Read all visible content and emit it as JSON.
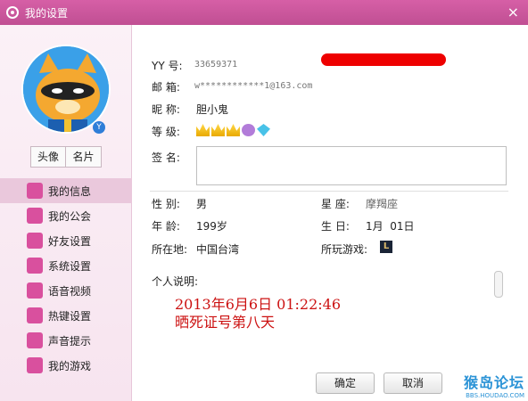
{
  "window": {
    "title": "我的设置",
    "close_label": "×"
  },
  "sidebar": {
    "avatar_badge": "Y",
    "tabs": [
      "头像",
      "名片"
    ],
    "items": [
      {
        "label": "我的信息",
        "icon": "profile-card-icon",
        "active": true
      },
      {
        "label": "我的公会",
        "icon": "flag-icon"
      },
      {
        "label": "好友设置",
        "icon": "friend-settings-icon"
      },
      {
        "label": "系统设置",
        "icon": "gear-icon"
      },
      {
        "label": "语音视频",
        "icon": "webcam-icon"
      },
      {
        "label": "热键设置",
        "icon": "keyboard-icon"
      },
      {
        "label": "声音提示",
        "icon": "music-note-icon"
      },
      {
        "label": "我的游戏",
        "icon": "game-icon"
      }
    ]
  },
  "profile": {
    "yy_label": "YY 号:",
    "yy_value": "33659371",
    "email_label": "邮 箱:",
    "email_value": "w************1@163.com",
    "nickname_label": "昵 称:",
    "nickname_value": "胆小鬼",
    "level_label": "等 级:",
    "signature_label": "签 名:",
    "gender_label": "性 别:",
    "gender_value": "男",
    "zodiac_label": "星 座:",
    "zodiac_value": "摩羯座",
    "age_label": "年 龄:",
    "age_value": "199岁",
    "birthday_label": "生 日:",
    "birthday_value": "1月  01日",
    "location_label": "所在地:",
    "location_value": "中国台湾",
    "game_label": "所玩游戏:",
    "game_icon_text": "L",
    "description_label": "个人说明:",
    "description_line1": "2013年6月6日 01:22:46",
    "description_line2": "晒死证号第八天"
  },
  "buttons": {
    "ok": "确定",
    "cancel": "取消"
  },
  "watermark": {
    "main": "猴岛论坛",
    "sub": "BBS.HOUDAO.COM"
  },
  "colors": {
    "titlebar": "#c04f93",
    "sidebar_active": "#eac8dc",
    "description_text": "#cc1111"
  }
}
